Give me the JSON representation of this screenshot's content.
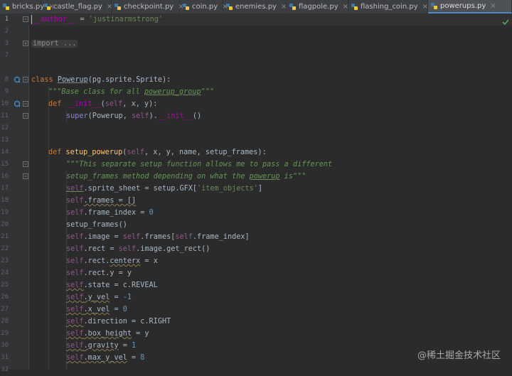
{
  "tabs": [
    {
      "label": "bricks.py",
      "active": false
    },
    {
      "label": "castle_flag.py",
      "active": false
    },
    {
      "label": "checkpoint.py",
      "active": false
    },
    {
      "label": "coin.py",
      "active": false
    },
    {
      "label": "enemies.py",
      "active": false
    },
    {
      "label": "flagpole.py",
      "active": false
    },
    {
      "label": "flashing_coin.py",
      "active": false
    },
    {
      "label": "powerups.py",
      "active": true
    }
  ],
  "tab_close_glyph": "×",
  "line_numbers": [
    "1",
    "2",
    "3",
    "7",
    "8",
    "9",
    "10",
    "11",
    "12",
    "13",
    "14",
    "15",
    "16",
    "17",
    "18",
    "19",
    "20",
    "21",
    "22",
    "23",
    "24",
    "25",
    "26",
    "27",
    "28",
    "29",
    "30",
    "31",
    "32"
  ],
  "code": {
    "l1_author": "__author__",
    "l1_eq": " = ",
    "l1_value": "'justinarmstrong'",
    "l3_import": "import ...",
    "l8_class": "class ",
    "l8_name": "Powerup",
    "l8_base": "(pg.sprite.Sprite):",
    "l9_doc_a": "\"\"\"Base class for all ",
    "l9_doc_b": "powerup_group",
    "l9_doc_c": "\"\"\"",
    "l10_def": "def ",
    "l10_name": "__init__",
    "l10_rest_a": "(",
    "l10_self": "self",
    "l10_rest_b": ", x, y):",
    "l11_super": "super",
    "l11_a": "(Powerup, ",
    "l11_self": "self",
    "l11_b": ").",
    "l11_init": "__init__",
    "l11_c": "()",
    "l14_def": "def ",
    "l14_name": "setup_powerup",
    "l14_a": "(",
    "l14_self": "self",
    "l14_b": ", x, y, name, setup_frames):",
    "l15_doc": "\"\"\"This separate setup function allows me to pass a different",
    "l16_doc_a": "setup_frames method depending on what the ",
    "l16_doc_b": "powerup",
    "l16_doc_c": " is\"\"\"",
    "l17_a": ".sprite_sheet = setup.GFX[",
    "l17_s": "'item_objects'",
    "l17_b": "]",
    "l18_a": ".frames = []",
    "l19_a": ".frame_index = ",
    "l19_n": "0",
    "l20_a": "setup_frames()",
    "l21_a": ".image = ",
    "l21_b": ".frames[",
    "l21_c": ".frame_index]",
    "l22_a": ".rect = ",
    "l22_b": ".image.get_rect()",
    "l23_a": ".rect.",
    "l23_b": "centerx",
    "l23_c": " = x",
    "l24_a": ".rect.y = y",
    "l25_a": ".state = c.REVEAL",
    "l26_a": ".y_vel",
    "l26_b": " = ",
    "l26_n": "-1",
    "l27_a": ".x_vel",
    "l27_b": " = ",
    "l27_n": "0",
    "l28_a": ".direction = c.RIGHT",
    "l29_a": ".box_height",
    "l29_b": " = y",
    "l30_a": ".gravity",
    "l30_b": " = ",
    "l30_n": "1",
    "l31_a": ".max_y_vel",
    "l31_b": " = ",
    "l31_n": "8",
    "self_kw": "self"
  },
  "watermark": "@稀土掘金技术社区",
  "colors": {
    "background": "#2b2b2b",
    "keyword": "#cc7832",
    "string": "#6a8759",
    "function": "#ffc66d",
    "self": "#94558d",
    "number": "#6897bb",
    "accent": "#4a88c7"
  }
}
